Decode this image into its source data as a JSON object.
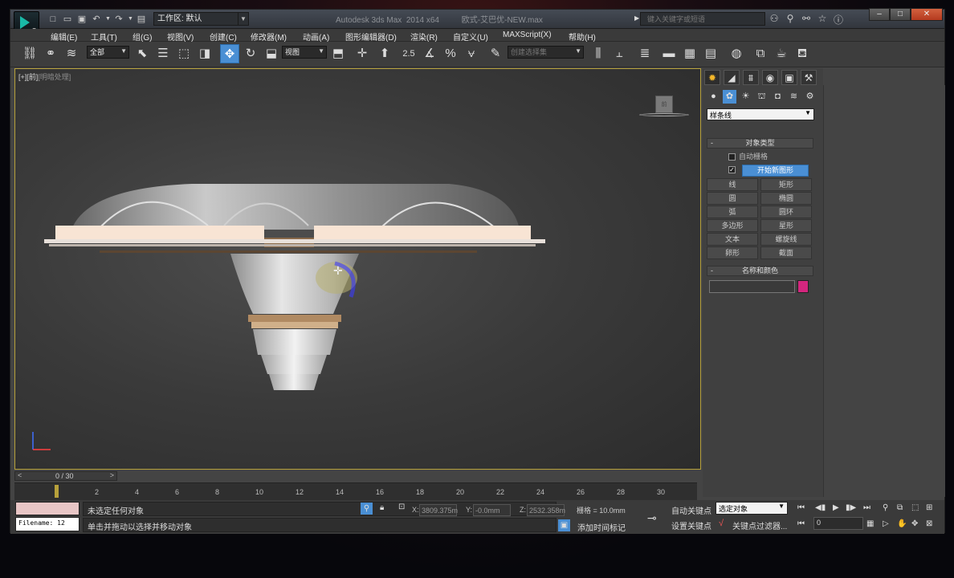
{
  "window": {
    "title_app": "Autodesk 3ds Max  2014 x64",
    "title_file": "欧式-艾巴优-NEW.max",
    "workspace_label": "工作区: 默认",
    "search_placeholder": "键入关键字或短语",
    "colors": {
      "accent": "#4a8fd4",
      "viewport_border": "#b7a13b",
      "swatch": "#d4267e"
    }
  },
  "menu": [
    "编辑(E)",
    "工具(T)",
    "组(G)",
    "视图(V)",
    "创建(C)",
    "修改器(M)",
    "动画(A)",
    "图形编辑器(D)",
    "渲染(R)",
    "自定义(U)",
    "MAXScript(X)",
    "帮助(H)"
  ],
  "toolbar": {
    "filter": "全部",
    "ref_coord": "视图",
    "snap_angle": "2.5",
    "snap_pct": "%",
    "named_sel": "创建选择集"
  },
  "viewport": {
    "label_plus": "[+]",
    "label_view": "[前]",
    "label_mode": "[明暗处理]",
    "viewcube_face": "前"
  },
  "time_slider": {
    "label": "0 / 30",
    "left": "<",
    "right": ">"
  },
  "timeline_ticks": [
    "2",
    "4",
    "6",
    "8",
    "10",
    "12",
    "14",
    "16",
    "18",
    "20",
    "22",
    "24",
    "26",
    "28",
    "30"
  ],
  "command_panel": {
    "category": "样条线",
    "rollout_object_type": "对象类型",
    "autogrid": "自动栅格",
    "start_new_shape": "开始新图形",
    "buttons": [
      "线",
      "矩形",
      "圆",
      "椭圆",
      "弧",
      "圆环",
      "多边形",
      "星形",
      "文本",
      "螺旋线",
      "卵形",
      "截面"
    ],
    "rollout_name_color": "名称和颜色"
  },
  "status": {
    "filename": "Filename: 12",
    "selection": "未选定任何对象",
    "prompt": "单击并拖动以选择并移动对象",
    "x_label": "X:",
    "x_value": "3809.375m",
    "y_label": "Y:",
    "y_value": "-0.0mm",
    "z_label": "Z:",
    "z_value": "2532.358m",
    "grid": "栅格 = 10.0mm",
    "add_time_tag": "添加时间标记"
  },
  "anim": {
    "auto_key": "自动关键点",
    "set_key": "设置关键点",
    "selected": "选定对象",
    "key_filters": "关键点过滤器...",
    "frame": "0"
  }
}
